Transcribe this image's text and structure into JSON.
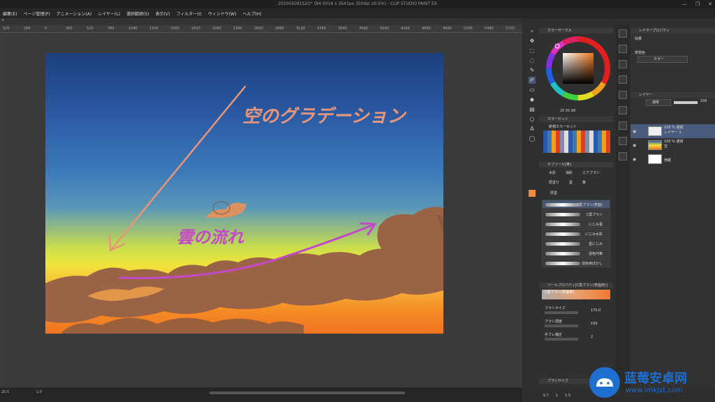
{
  "window": {
    "title": "20200509152O° (B4 5016 x 3541px 350dpi 20.5%) - CLIP STUDIO PAINT EX",
    "controls": [
      "—",
      "❐",
      "✕"
    ]
  },
  "menu": [
    "編集(E)",
    "ページ管理(P)",
    "アニメーション(A)",
    "レイヤー(L)",
    "選択範囲(S)",
    "表示(V)",
    "フィルター(I)",
    "ウィンドウ(W)",
    "ヘルプ(H)"
  ],
  "ruler": [
    "520",
    "260",
    "0",
    "260",
    "520",
    "780",
    "1040",
    "1300",
    "1560",
    "1820",
    "2080",
    "2340",
    "2600",
    "2860",
    "3120",
    "3380",
    "3640",
    "3900",
    "4160",
    "4420",
    "4680",
    "4940",
    "5200",
    "5460",
    "5720"
  ],
  "canvas": {
    "annotation_sky": "空のグラデーション",
    "annotation_clouds": "雲の流れ",
    "sky_color": "#e8967a",
    "cloud_color": "#c24ac8"
  },
  "status": {
    "zoom": "20.5",
    "angle": "1.0"
  },
  "color_panel": {
    "title": "カラーサークル",
    "readout": "20  65  88"
  },
  "color_set": {
    "title": "カラーセット",
    "set_name": "新規カラーセット"
  },
  "subtool": {
    "title": "サブツール[筆]",
    "tabs": [
      "水彩",
      "油彩",
      "エアブラシ",
      "厚塗り",
      "墨",
      "筆"
    ],
    "group": "厚塗",
    "brushes": [
      "C雲ブラシ(表面)",
      "C雲ブラシ",
      "にじみ墨",
      "にじみ水彩",
      "墨にじみ",
      "混色円筆",
      "混色用ぼかし"
    ],
    "active_brush": 0
  },
  "tool_property": {
    "title": "ツールプロパティ[C雲ブラシ(表面用)]",
    "brush_name": "C雲ブラシ(表面用)",
    "brush_size_label": "ブラシサイズ",
    "brush_size": "170.0",
    "brush_density_label": "ブラシ濃度",
    "brush_density": "100",
    "stabilization_label": "手ブレ補正",
    "stabilization": "2"
  },
  "bottom_panel": {
    "title": "ブラシサイズ",
    "values": [
      "0.7",
      "1",
      "1.5"
    ]
  },
  "layer_prop": {
    "title": "レイヤープロパティ",
    "effect_label": "効果",
    "expression_label": "表現色",
    "expression_value": "カラー"
  },
  "layer_panel": {
    "title": "レイヤー",
    "blend_mode": "通常",
    "opacity": "100",
    "layers": [
      {
        "line1": "100 % 通常",
        "line2": "レイヤー 1",
        "active": true
      },
      {
        "line1": "100 % 通常",
        "line2": "空",
        "active": false
      },
      {
        "line1": "",
        "line2": "用紙",
        "active": false
      }
    ]
  },
  "watermark": {
    "name": "蓝莓安卓网",
    "url": "www.lmkjst.com"
  }
}
